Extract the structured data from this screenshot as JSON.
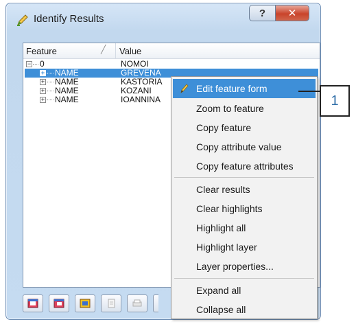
{
  "window": {
    "title": "Identify Results",
    "help_symbol": "?",
    "close_symbol": "✕"
  },
  "tree": {
    "headers": {
      "feature": "Feature",
      "value": "Value"
    },
    "root": {
      "label": "0",
      "value": "NOMOI"
    },
    "rows": [
      {
        "label": "NAME",
        "value": "GREVENA",
        "selected": true
      },
      {
        "label": "NAME",
        "value": "KASTORIA",
        "selected": false
      },
      {
        "label": "NAME",
        "value": "KOZANI",
        "selected": false
      },
      {
        "label": "NAME",
        "value": "IOANNINA",
        "selected": false
      }
    ]
  },
  "context_menu": {
    "items": [
      "Edit feature form",
      "Zoom to feature",
      "Copy feature",
      "Copy attribute value",
      "Copy feature attributes",
      "Clear results",
      "Clear highlights",
      "Highlight all",
      "Highlight layer",
      "Layer properties...",
      "Expand all",
      "Collapse all"
    ]
  },
  "callout": {
    "label": "1"
  },
  "colors": {
    "selection": "#3e8fd8",
    "title_gradient": "#c2d8ee",
    "close_button": "#c9442b",
    "callout_text": "#2f6ea8"
  },
  "icons": {
    "app": "identify-pencil-icon",
    "menu_edit": "pencil-icon",
    "toolbar": [
      "expand-tree-icon",
      "collapse-tree-icon",
      "expand-new-icon",
      "copy-icon",
      "print-icon"
    ]
  }
}
